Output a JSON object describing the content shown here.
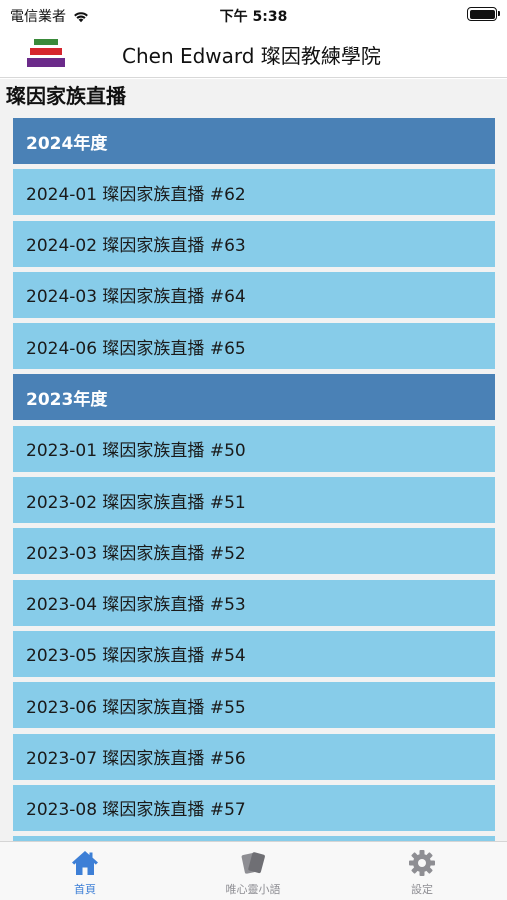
{
  "status_bar": {
    "carrier": "電信業者",
    "time": "下午 5:38"
  },
  "header": {
    "title": "Chen Edward  璨因教練學院",
    "logo_icon": "stacked-books-logo"
  },
  "page": {
    "title": "璨因家族直播"
  },
  "list": [
    {
      "type": "section",
      "label": "2024年度"
    },
    {
      "type": "item",
      "label": "2024-01 璨因家族直播 #62"
    },
    {
      "type": "item",
      "label": "2024-02 璨因家族直播 #63"
    },
    {
      "type": "item",
      "label": "2024-03 璨因家族直播 #64"
    },
    {
      "type": "item",
      "label": "2024-06 璨因家族直播 #65"
    },
    {
      "type": "section",
      "label": "2023年度"
    },
    {
      "type": "item",
      "label": "2023-01 璨因家族直播 #50"
    },
    {
      "type": "item",
      "label": "2023-02 璨因家族直播 #51"
    },
    {
      "type": "item",
      "label": "2023-03 璨因家族直播 #52"
    },
    {
      "type": "item",
      "label": "2023-04 璨因家族直播 #53"
    },
    {
      "type": "item",
      "label": "2023-05 璨因家族直播 #54"
    },
    {
      "type": "item",
      "label": "2023-06 璨因家族直播 #55"
    },
    {
      "type": "item",
      "label": "2023-07 璨因家族直播 #56"
    },
    {
      "type": "item",
      "label": "2023-08 璨因家族直播 #57"
    },
    {
      "type": "item",
      "label": ""
    }
  ],
  "tabs": [
    {
      "label": "首頁",
      "icon": "home-icon",
      "active": true
    },
    {
      "label": "唯心靈小語",
      "icon": "cards-icon",
      "active": false
    },
    {
      "label": "設定",
      "icon": "gear-icon",
      "active": false
    }
  ],
  "colors": {
    "section": "#4a81b6",
    "item": "#87cce9",
    "tab_active": "#3d7fd6",
    "tab_inactive": "#8e8e93"
  }
}
